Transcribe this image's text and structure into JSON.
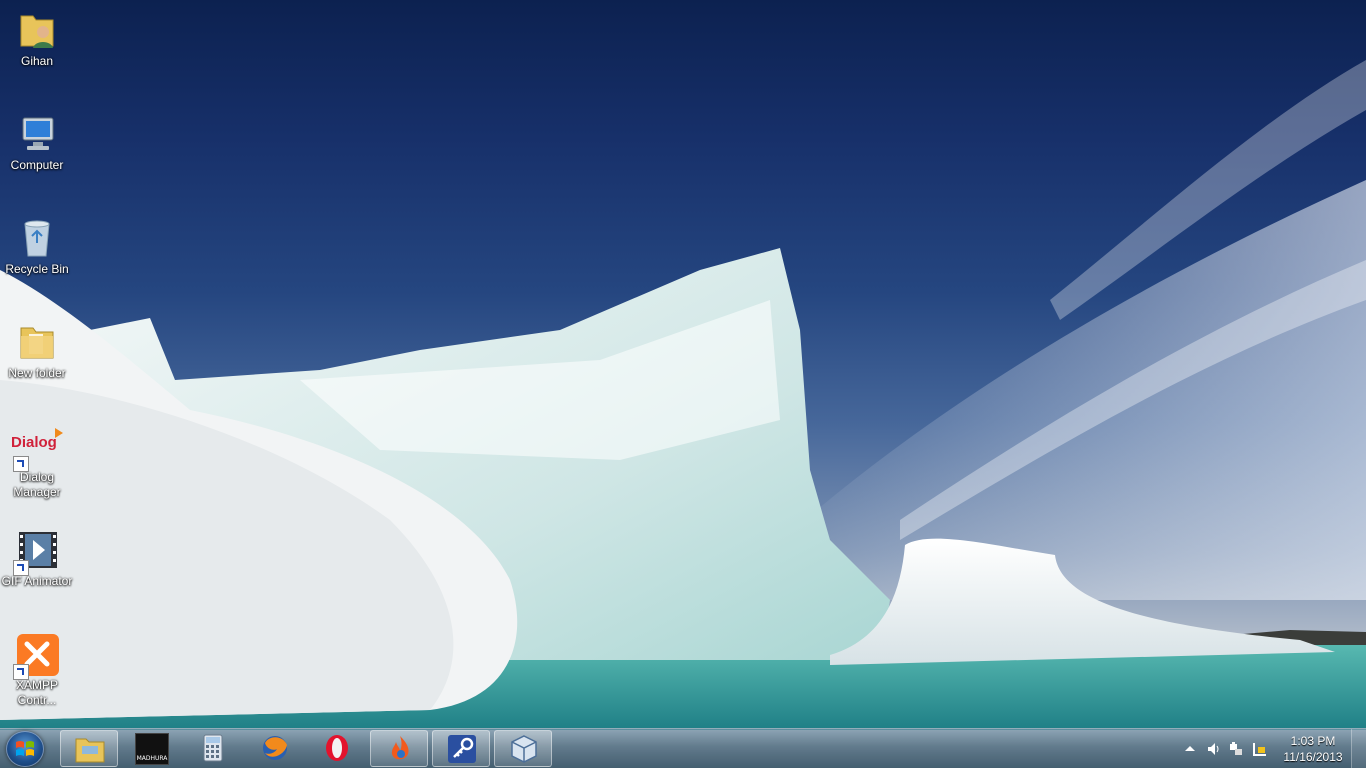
{
  "desktop": {
    "icons": [
      {
        "label": "Gihan",
        "icon": "user-folder-icon"
      },
      {
        "label": "Computer",
        "icon": "computer-icon"
      },
      {
        "label": "Recycle Bin",
        "icon": "recycle-bin-icon"
      },
      {
        "label": "New folder",
        "icon": "folder-icon"
      },
      {
        "label": "Dialog Manager",
        "icon": "dialog-logo-icon"
      },
      {
        "label": "GIF Animator",
        "icon": "film-icon"
      },
      {
        "label": "XAMPP Contr...",
        "icon": "xampp-icon"
      }
    ],
    "dialog_logo_text": "Dialog"
  },
  "taskbar": {
    "start": "start-button",
    "pinned": [
      {
        "name": "windows-explorer",
        "icon": "folder-icon",
        "active": true
      },
      {
        "name": "madhura-dictionary",
        "icon": "madhura-icon",
        "active": false,
        "text": "MADHURA"
      },
      {
        "name": "calculator",
        "icon": "calculator-icon",
        "active": false
      },
      {
        "name": "firefox",
        "icon": "firefox-icon",
        "active": false
      },
      {
        "name": "opera",
        "icon": "opera-icon",
        "active": false
      },
      {
        "name": "media-player",
        "icon": "flame-icon",
        "active": true
      },
      {
        "name": "key-app",
        "icon": "key-icon",
        "active": true
      },
      {
        "name": "virtualbox",
        "icon": "cube-icon",
        "active": true
      }
    ],
    "tray": {
      "icons": [
        "chevron-up-icon",
        "speaker-icon",
        "network-icon",
        "action-center-icon"
      ],
      "time": "1:03 PM",
      "date": "11/16/2013"
    }
  },
  "colors": {
    "sky_top": "#0c2150",
    "ice": "#eef4f4",
    "water": "#3aa6a0",
    "orb": "#1f4f8c"
  }
}
